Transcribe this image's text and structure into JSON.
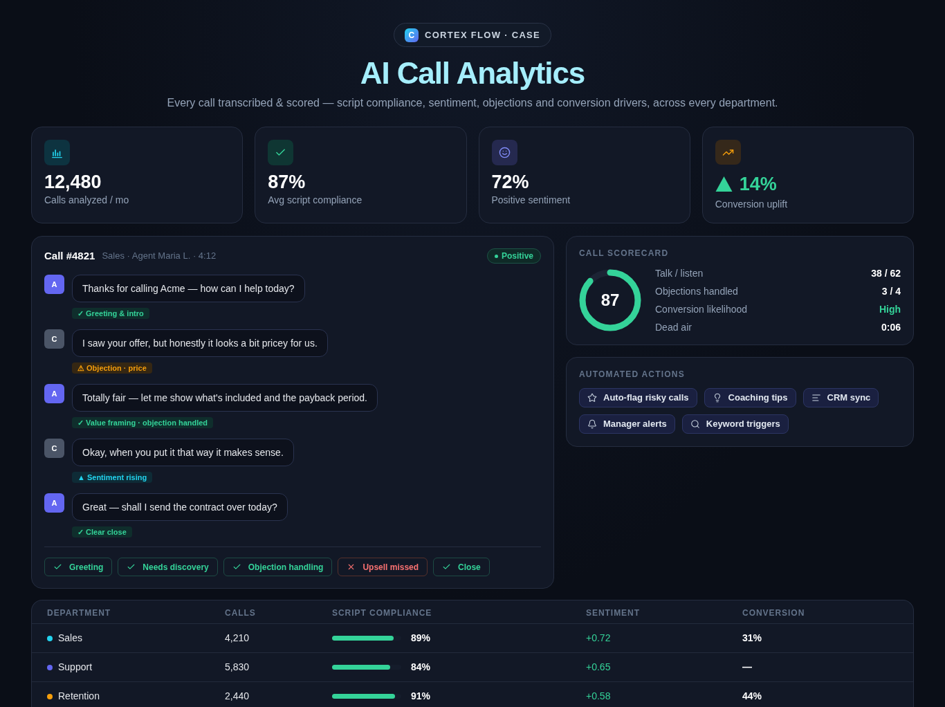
{
  "header": {
    "logo_letter": "C",
    "brand": "CORTEX FLOW · CASE",
    "title": "AI Call Analytics",
    "subtitle": "Every call transcribed & scored — script compliance, sentiment, objections and conversion drivers, across every department."
  },
  "stats": [
    {
      "kind": "calls",
      "value": "12,480",
      "label": "Calls analyzed / mo"
    },
    {
      "kind": "compliance",
      "value": "87%",
      "label": "Avg script compliance"
    },
    {
      "kind": "sentiment",
      "value": "72%",
      "label": "Positive sentiment"
    },
    {
      "kind": "uplift",
      "value": "14%",
      "label": "Conversion uplift"
    }
  ],
  "call": {
    "title": "Call #4821",
    "meta": "Sales · Agent Maria L. · 4:12",
    "sentiment": {
      "kind": "positive",
      "label": "Positive"
    },
    "messages": [
      {
        "kind": "agent",
        "speaker": "A",
        "text": "Thanks for calling Acme — how can I help today?",
        "tag": {
          "kind": "positive",
          "text": "✓ Greeting & intro"
        }
      },
      {
        "kind": "customer",
        "speaker": "C",
        "text": "I saw your offer, but honestly it looks a bit pricey for us.",
        "tag": {
          "kind": "warning",
          "text": "⚠ Objection · price"
        }
      },
      {
        "kind": "agent",
        "speaker": "A",
        "text": "Totally fair — let me show what's included and the payback period.",
        "tag": {
          "kind": "positive",
          "text": "✓ Value framing · objection handled"
        }
      },
      {
        "kind": "customer",
        "speaker": "C",
        "text": "Okay, when you put it that way it makes sense.",
        "tag": {
          "kind": "info",
          "text": "▲ Sentiment rising"
        }
      },
      {
        "kind": "agent",
        "speaker": "A",
        "text": "Great — shall I send the contract over today?",
        "tag": {
          "kind": "positive",
          "text": "✓ Clear close"
        }
      }
    ],
    "checklist": [
      {
        "label": "Greeting",
        "passed": true
      },
      {
        "label": "Needs discovery",
        "passed": true
      },
      {
        "label": "Objection handling",
        "passed": true
      },
      {
        "label": "Upsell missed",
        "passed": false
      },
      {
        "label": "Close",
        "passed": true
      }
    ]
  },
  "scorecard": {
    "title": "CALL SCORECARD",
    "score": "87",
    "level": 0.87,
    "rows": [
      {
        "label": "Talk / listen",
        "value": "38 / 62",
        "highlight": false
      },
      {
        "label": "Objections handled",
        "value": "3 / 4",
        "highlight": false
      },
      {
        "label": "Conversion likelihood",
        "value": "High",
        "highlight": true
      },
      {
        "label": "Dead air",
        "value": "0:06",
        "highlight": false
      }
    ]
  },
  "actions": {
    "title": "AUTOMATED ACTIONS",
    "items": [
      {
        "kind": "star",
        "label": "Auto-flag risky calls"
      },
      {
        "kind": "bulb",
        "label": "Coaching tips"
      },
      {
        "kind": "lines",
        "label": "CRM sync"
      },
      {
        "kind": "bell",
        "label": "Manager alerts"
      },
      {
        "kind": "search",
        "label": "Keyword triggers"
      }
    ]
  },
  "table": {
    "columns": [
      "DEPARTMENT",
      "CALLS",
      "SCRIPT COMPLIANCE",
      "SENTIMENT",
      "CONVERSION"
    ],
    "rows": [
      {
        "department": "Sales",
        "color": "#22d3ee",
        "calls": "4,210",
        "level": 0.89,
        "compliance": "89%",
        "sentiment": "+0.72",
        "conversion": "31%"
      },
      {
        "department": "Support",
        "color": "#6366f1",
        "calls": "5,830",
        "level": 0.84,
        "compliance": "84%",
        "sentiment": "+0.65",
        "conversion": "—"
      },
      {
        "department": "Retention",
        "color": "#f59e0b",
        "calls": "2,440",
        "level": 0.91,
        "compliance": "91%",
        "sentiment": "+0.58",
        "conversion": "44%"
      }
    ]
  }
}
